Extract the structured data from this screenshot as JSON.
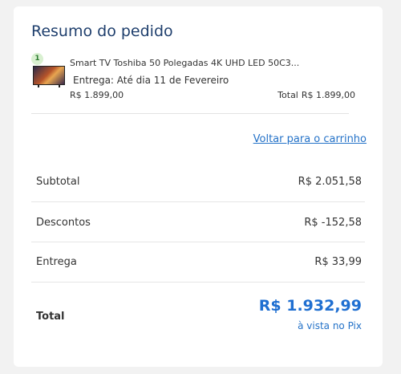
{
  "order_summary": {
    "title": "Resumo do pedido",
    "item": {
      "quantity": "1",
      "name": "Smart TV Toshiba 50 Polegadas 4K UHD LED 50C3...",
      "delivery": "Entrega: Até dia 11 de Fevereiro",
      "unit_price": "R$ 1.899,00",
      "total_label": "Total",
      "total_value": "R$ 1.899,00",
      "image_icon": "tv-product-thumbnail"
    },
    "back_link": "Voltar para o carrinho",
    "rows": [
      {
        "label": "Subtotal",
        "value": "R$ 2.051,58"
      },
      {
        "label": "Descontos",
        "value": "R$ -152,58"
      },
      {
        "label": "Entrega",
        "value": "R$ 33,99"
      }
    ],
    "total": {
      "label": "Total",
      "value": "R$ 1.932,99",
      "note": "à vista no Pix"
    }
  },
  "colors": {
    "title": "#1f3f6d",
    "link": "#2472c8",
    "total_value": "#1f6fd1",
    "badge_bg": "#d9f0d1",
    "badge_text": "#2e7d32"
  }
}
